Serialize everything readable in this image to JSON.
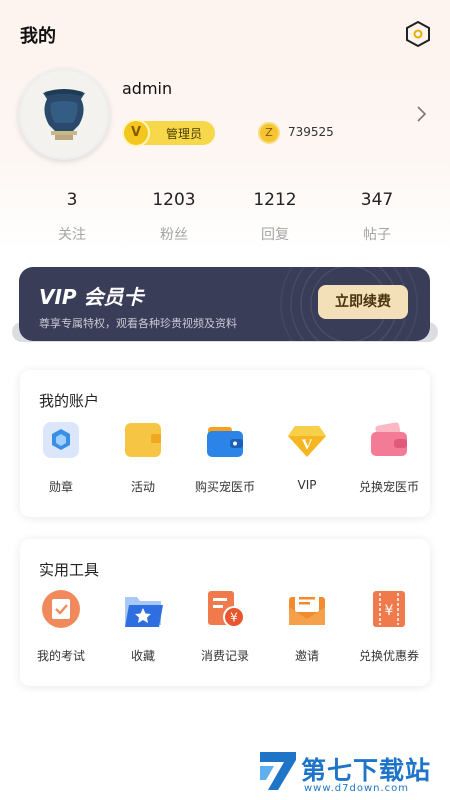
{
  "header": {
    "title": "我的"
  },
  "profile": {
    "username": "admin",
    "role": "管理员",
    "role_icon_letter": "V",
    "points": "739525",
    "points_icon_letter": "Z"
  },
  "stats": [
    {
      "value": "3",
      "label": "关注"
    },
    {
      "value": "1203",
      "label": "粉丝"
    },
    {
      "value": "1212",
      "label": "回复"
    },
    {
      "value": "347",
      "label": "帖子"
    }
  ],
  "vip": {
    "title": "VIP 会员卡",
    "subtitle": "尊享专属特权，观看各种珍贵视频及资料",
    "button": "立即续费"
  },
  "account": {
    "title": "我的账户",
    "items": [
      {
        "label": "勋章",
        "icon": "medal-icon"
      },
      {
        "label": "活动",
        "icon": "wallet-icon"
      },
      {
        "label": "购买宠医币",
        "icon": "purse-icon"
      },
      {
        "label": "VIP",
        "icon": "diamond-icon"
      },
      {
        "label": "兑换宠医币",
        "icon": "exchange-coin-icon"
      }
    ]
  },
  "tools": {
    "title": "实用工具",
    "items": [
      {
        "label": "我的考试",
        "icon": "exam-icon"
      },
      {
        "label": "收藏",
        "icon": "favorite-folder-icon"
      },
      {
        "label": "消费记录",
        "icon": "consumption-record-icon"
      },
      {
        "label": "邀请",
        "icon": "invite-envelope-icon"
      },
      {
        "label": "兑换优惠券",
        "icon": "coupon-icon"
      }
    ]
  },
  "watermark": {
    "name": "第七下载站",
    "url": "www.d7down.com"
  },
  "colors": {
    "accent": "#f3c71e",
    "vip_bg": "#3a3d57",
    "vip_button": "#f3e0b8",
    "watermark": "#1e75c8"
  }
}
